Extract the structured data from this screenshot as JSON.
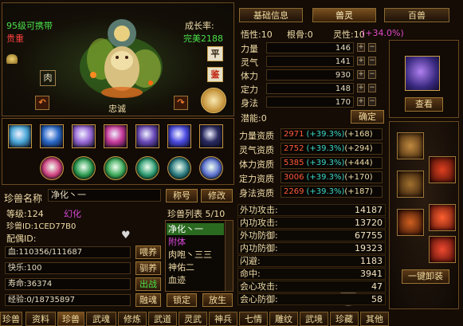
{
  "pet": {
    "level_title": "95级可携带",
    "rarity": "贵重",
    "growth_label": "成长率:",
    "growth_value": "完美2188",
    "loyalty": "忠诚",
    "badge_flat": "平",
    "badge_appraise": "鉴",
    "badge_flesh": "肉"
  },
  "skills_row1": [
    "#4aa8d8",
    "#2a6ac8",
    "#9a6ad8",
    "#c83a9a",
    "#6a4ab8",
    "#4a4ae0",
    "#2a2a60"
  ],
  "skills_row2": [
    "#d04080",
    "#2a9a50",
    "#3aa858",
    "#2a9a70",
    "#2a7a80",
    "#5a70d0"
  ],
  "rename": {
    "label": "珍兽名称",
    "value": "净化丶一",
    "nickname_button": "称号",
    "modify_button": "修改"
  },
  "info": {
    "level_label": "等级:124",
    "type_label": "幻化",
    "id_label": "珍兽ID:1CED77B0",
    "mate_label": "配偶ID:",
    "blood": "血:110356/111687",
    "feed_button": "喂养",
    "happy": "快乐:100",
    "tame_button": "驯养",
    "life": "寿命:36374",
    "fight_button": "出战",
    "exp": "经验:0/18735897",
    "merge_button": "融魂"
  },
  "list": {
    "title": "珍兽列表 5/10",
    "items": [
      "净化丶一",
      "附体",
      "肉咆丶三三",
      "神佑二",
      "血迹"
    ],
    "lock_button": "锁定",
    "release_button": "放生"
  },
  "tabs": {
    "basic": "基础信息",
    "spirit": "兽灵",
    "beasts": "百兽"
  },
  "attrs": {
    "insight": "悟性:10",
    "root": "根骨:0",
    "spirituality": "灵性:10",
    "spirituality_bonus": "(+34.0%)",
    "stats": [
      {
        "name": "力量",
        "value": "146"
      },
      {
        "name": "灵气",
        "value": "141"
      },
      {
        "name": "体力",
        "value": "930"
      },
      {
        "name": "定力",
        "value": "148"
      },
      {
        "name": "身法",
        "value": "170"
      }
    ],
    "potential": "潜能:0",
    "confirm_button": "确定"
  },
  "aptitudes": [
    {
      "name": "力量资质",
      "base": "2971",
      "bonus": "(+39.3%)",
      "extra": "(+168)"
    },
    {
      "name": "灵气资质",
      "base": "2752",
      "bonus": "(+39.3%)",
      "extra": "(+294)"
    },
    {
      "name": "体力资质",
      "base": "5385",
      "bonus": "(+39.3%)",
      "extra": "(+444)"
    },
    {
      "name": "定力资质",
      "base": "3006",
      "bonus": "(+39.3%)",
      "extra": "(+170)"
    },
    {
      "name": "身法资质",
      "base": "2269",
      "bonus": "(+39.3%)",
      "extra": "(+187)"
    }
  ],
  "combat": [
    {
      "name": "外功攻击:",
      "value": "14187"
    },
    {
      "name": "内功攻击:",
      "value": "13720"
    },
    {
      "name": "外功防御:",
      "value": "67755"
    },
    {
      "name": "内功防御:",
      "value": "19323"
    },
    {
      "name": "闪避:",
      "value": "1183"
    },
    {
      "name": "命中:",
      "value": "3941"
    },
    {
      "name": "会心攻击:",
      "value": "47"
    },
    {
      "name": "会心防御:",
      "value": "58"
    }
  ],
  "side": {
    "view_button": "查看",
    "unequip_all_button": "一键卸装"
  },
  "bottom_tabs": [
    "珍兽",
    "资料",
    "珍兽",
    "武魂",
    "修炼",
    "武道",
    "灵武",
    "神兵",
    "七情",
    "雕纹",
    "武境",
    "珍藏",
    "其他"
  ],
  "colors": {
    "accent": "#f0c860",
    "green": "#4ae04a",
    "red": "#ff4040",
    "aptitude": "#ff5a3a",
    "bonus": "#3ad8c8",
    "spirit_bonus": "#e04ac8",
    "magenta": "#d848d8"
  }
}
